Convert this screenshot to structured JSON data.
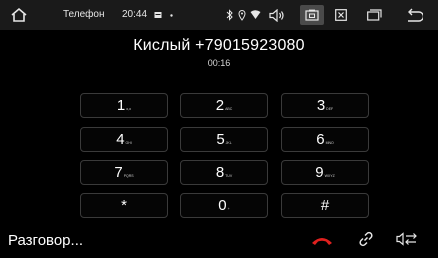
{
  "statusbar": {
    "title": "Телефон",
    "time": "20:44"
  },
  "call": {
    "caller": "Кислый +79015923080",
    "duration": "00:16",
    "status": "Разговор..."
  },
  "keypad": [
    {
      "digit": "1",
      "sub": "o,o"
    },
    {
      "digit": "2",
      "sub": "ABC"
    },
    {
      "digit": "3",
      "sub": "DEF"
    },
    {
      "digit": "4",
      "sub": "GHI"
    },
    {
      "digit": "5",
      "sub": "JKL"
    },
    {
      "digit": "6",
      "sub": "MNO"
    },
    {
      "digit": "7",
      "sub": "PQRS"
    },
    {
      "digit": "8",
      "sub": "TUV"
    },
    {
      "digit": "9",
      "sub": "WXYZ"
    },
    {
      "digit": "*",
      "sub": ""
    },
    {
      "digit": "0",
      "sub": "+"
    },
    {
      "digit": "#",
      "sub": ""
    }
  ],
  "colors": {
    "hangup": "#e0201e",
    "statusbar_bg": "#1a1a1a"
  }
}
